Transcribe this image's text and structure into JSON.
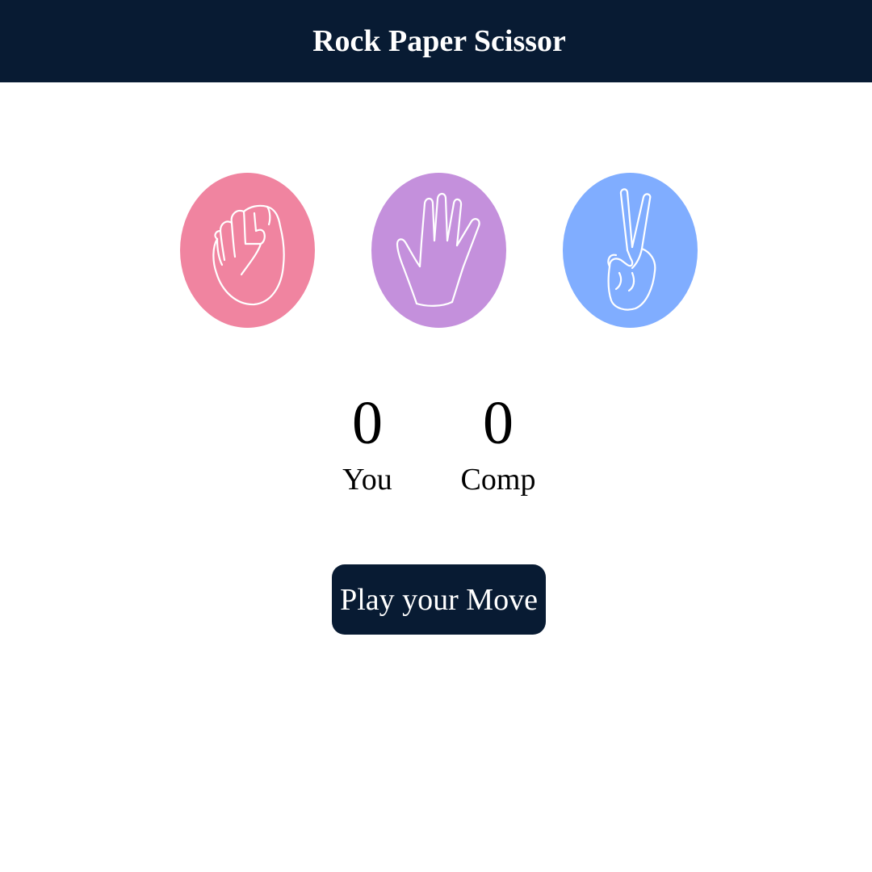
{
  "header": {
    "title": "Rock Paper Scissor"
  },
  "choices": [
    {
      "id": "rock",
      "icon": "fist-icon",
      "color": "#f084a0"
    },
    {
      "id": "paper",
      "icon": "open-hand-icon",
      "color": "#c490dc"
    },
    {
      "id": "scissors",
      "icon": "peace-sign-icon",
      "color": "#80adff"
    }
  ],
  "scores": {
    "user": {
      "value": "0",
      "label": "You"
    },
    "comp": {
      "value": "0",
      "label": "Comp"
    }
  },
  "play_button": {
    "label": "Play your Move"
  },
  "colors": {
    "dark": "#081b33",
    "text_light": "#ffffff"
  }
}
